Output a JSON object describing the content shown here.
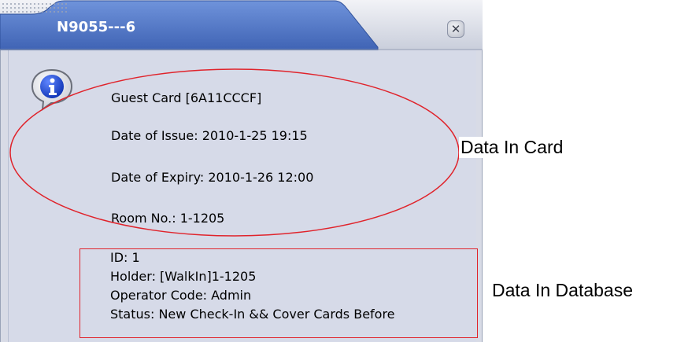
{
  "window": {
    "title": "N9055---6",
    "colors": {
      "title_blue": "#4a73c4",
      "body": "#d6dae8",
      "annotation_red": "#e0232b"
    }
  },
  "card_info": {
    "guest_card": "Guest Card [6A11CCCF]",
    "date_of_issue": "Date of Issue:  2010-1-25 19:15",
    "date_of_expiry": "Date of Expiry:  2010-1-26 12:00",
    "room_no": "Room No.:  1-1205"
  },
  "database_info": {
    "id": "ID:    1",
    "holder": "Holder:   [WalkIn]1-1205",
    "operator_code": "Operator Code:   Admin",
    "status": "Status:   New Check-In && Cover Cards Before"
  },
  "annotations": {
    "card": "Data In Card",
    "database": "Data In Database"
  },
  "icons": {
    "info": "info-icon",
    "close": "close-icon"
  }
}
